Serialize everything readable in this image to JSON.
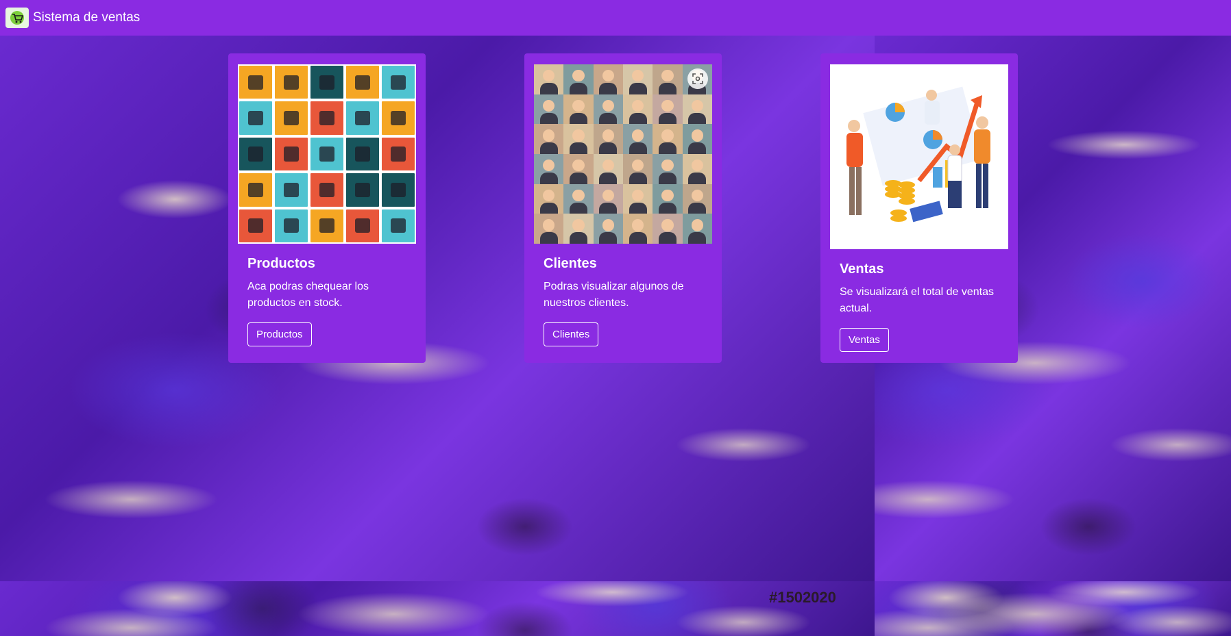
{
  "navbar": {
    "brand": "Sistema de ventas",
    "logo_icon": "shopping-cart-icon"
  },
  "background": {
    "watermark": "#1502020"
  },
  "cards": [
    {
      "title": "Productos",
      "text": "Aca podras chequear los productos en stock.",
      "button": "Productos",
      "image": "electronics-icons-grid"
    },
    {
      "title": "Clientes",
      "text": "Podras visualizar algunos de nuestros clientes.",
      "button": "Clientes",
      "image": "customer-avatars-grid"
    },
    {
      "title": "Ventas",
      "text": "Se visualizará el total de ventas actual.",
      "button": "Ventas",
      "image": "sales-team-illustration"
    }
  ],
  "colors": {
    "primary": "#8a2be2",
    "text": "#ffffff"
  }
}
